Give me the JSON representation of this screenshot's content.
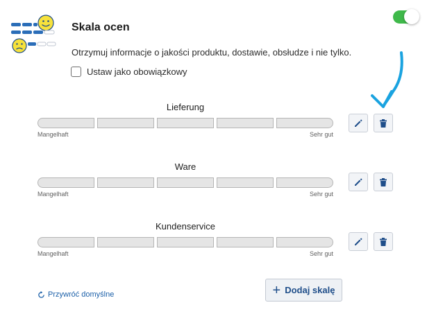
{
  "header": {
    "title": "Skala ocen",
    "description": "Otrzymuj informacje o jakości produktu, dostawie, obsłudze i nie tylko.",
    "mandatory_label": "Ustaw jako obowiązkowy",
    "toggle_on": true
  },
  "scales": [
    {
      "name": "Lieferung",
      "min_label": "Mangelhaft",
      "max_label": "Sehr gut"
    },
    {
      "name": "Ware",
      "min_label": "Mangelhaft",
      "max_label": "Sehr gut"
    },
    {
      "name": "Kundenservice",
      "min_label": "Mangelhaft",
      "max_label": "Sehr gut"
    }
  ],
  "footer": {
    "reset_label": "Przywróć domyślne",
    "add_label": "Dodaj skalę"
  },
  "colors": {
    "accent": "#1f4e8a",
    "toggle_on": "#3fb94a",
    "annotation": "#1aa3e0",
    "smiley": "#f7e23c"
  },
  "icons": {
    "edit": "pencil-icon",
    "delete": "trash-icon",
    "reset": "refresh-icon",
    "add": "plus-icon"
  }
}
